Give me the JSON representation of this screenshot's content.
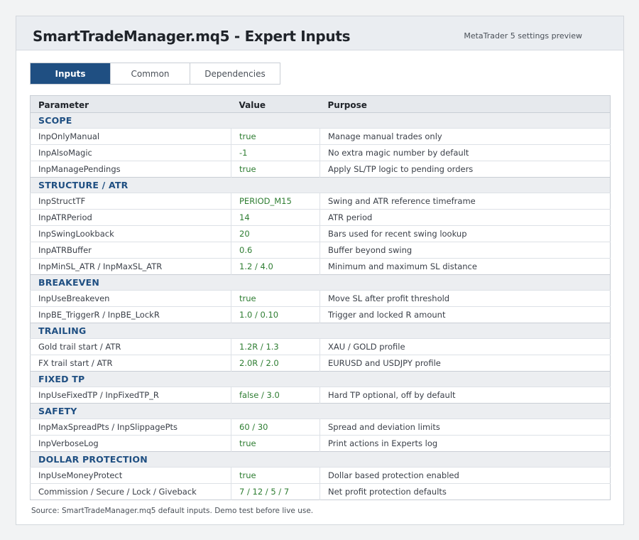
{
  "header": {
    "title": "SmartTradeManager.mq5 - Expert Inputs",
    "subtitle": "MetaTrader 5 settings preview"
  },
  "tabs": [
    {
      "label": "Inputs",
      "active": true
    },
    {
      "label": "Common",
      "active": false
    },
    {
      "label": "Dependencies",
      "active": false
    }
  ],
  "table": {
    "columns": [
      "Parameter",
      "Value",
      "Purpose"
    ],
    "rows": [
      {
        "section": "SCOPE"
      },
      {
        "param": "InpOnlyManual",
        "value": "true",
        "purpose": "Manage manual trades only"
      },
      {
        "param": "InpAlsoMagic",
        "value": "-1",
        "purpose": "No extra magic number by default"
      },
      {
        "param": "InpManagePendings",
        "value": "true",
        "purpose": "Apply SL/TP logic to pending orders"
      },
      {
        "section": "STRUCTURE / ATR"
      },
      {
        "param": "InpStructTF",
        "value": "PERIOD_M15",
        "purpose": "Swing and ATR reference timeframe"
      },
      {
        "param": "InpATRPeriod",
        "value": "14",
        "purpose": "ATR period"
      },
      {
        "param": "InpSwingLookback",
        "value": "20",
        "purpose": "Bars used for recent swing lookup"
      },
      {
        "param": "InpATRBuffer",
        "value": "0.6",
        "purpose": "Buffer beyond swing"
      },
      {
        "param": "InpMinSL_ATR / InpMaxSL_ATR",
        "value": "1.2 / 4.0",
        "purpose": "Minimum and maximum SL distance"
      },
      {
        "section": "BREAKEVEN"
      },
      {
        "param": "InpUseBreakeven",
        "value": "true",
        "purpose": "Move SL after profit threshold"
      },
      {
        "param": "InpBE_TriggerR / InpBE_LockR",
        "value": "1.0 / 0.10",
        "purpose": "Trigger and locked R amount"
      },
      {
        "section": "TRAILING"
      },
      {
        "param": "Gold trail start / ATR",
        "value": "1.2R / 1.3",
        "purpose": "XAU / GOLD profile"
      },
      {
        "param": "FX trail start / ATR",
        "value": "2.0R / 2.0",
        "purpose": "EURUSD and USDJPY profile"
      },
      {
        "section": "FIXED TP"
      },
      {
        "param": "InpUseFixedTP / InpFixedTP_R",
        "value": "false / 3.0",
        "purpose": "Hard TP optional, off by default"
      },
      {
        "section": "SAFETY"
      },
      {
        "param": "InpMaxSpreadPts / InpSlippagePts",
        "value": "60 / 30",
        "purpose": "Spread and deviation limits"
      },
      {
        "param": "InpVerboseLog",
        "value": "true",
        "purpose": "Print actions in Experts log"
      },
      {
        "section": "DOLLAR PROTECTION"
      },
      {
        "param": "InpUseMoneyProtect",
        "value": "true",
        "purpose": "Dollar based protection enabled"
      },
      {
        "param": "Commission / Secure / Lock / Giveback",
        "value": "7 / 12 / 5 / 7",
        "purpose": "Net profit protection defaults"
      }
    ]
  },
  "footer": {
    "note": "Source: SmartTradeManager.mq5 default inputs. Demo test before live use."
  },
  "colors": {
    "accent": "#1f4f82",
    "value_text": "#2e7d32"
  }
}
